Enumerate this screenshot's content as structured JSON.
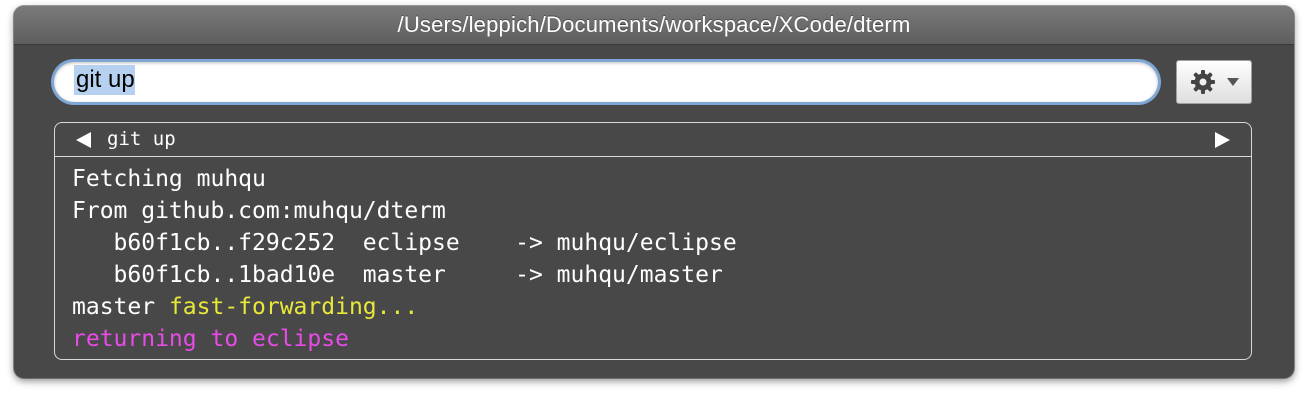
{
  "window": {
    "title": "/Users/leppich/Documents/workspace/XCode/dterm"
  },
  "search": {
    "value": "git up"
  },
  "toolbar": {
    "action_menu_icon": "gear-icon",
    "dropdown_icon": "chevron-down-icon"
  },
  "panel": {
    "command": "git up",
    "prev_icon": "triangle-left-icon",
    "next_icon": "triangle-right-icon"
  },
  "output": {
    "lines": [
      {
        "text": "Fetching muhqu"
      },
      {
        "text": "From github.com:muhqu/dterm"
      },
      {
        "text": "   b60f1cb..f29c252  eclipse    -> muhqu/eclipse"
      },
      {
        "text": "   b60f1cb..1bad10e  master     -> muhqu/master"
      },
      {
        "prefix": "master ",
        "highlight": "fast-forwarding..."
      },
      {
        "text": "returning to eclipse"
      }
    ]
  },
  "colors": {
    "window_bg": "#484848",
    "titlebar": "#6e6e6e",
    "focus_ring": "#7fa7d6",
    "selection": "#b5d1ef",
    "yellow_text": "#e8e83a",
    "magenta_text": "#e84be8"
  }
}
